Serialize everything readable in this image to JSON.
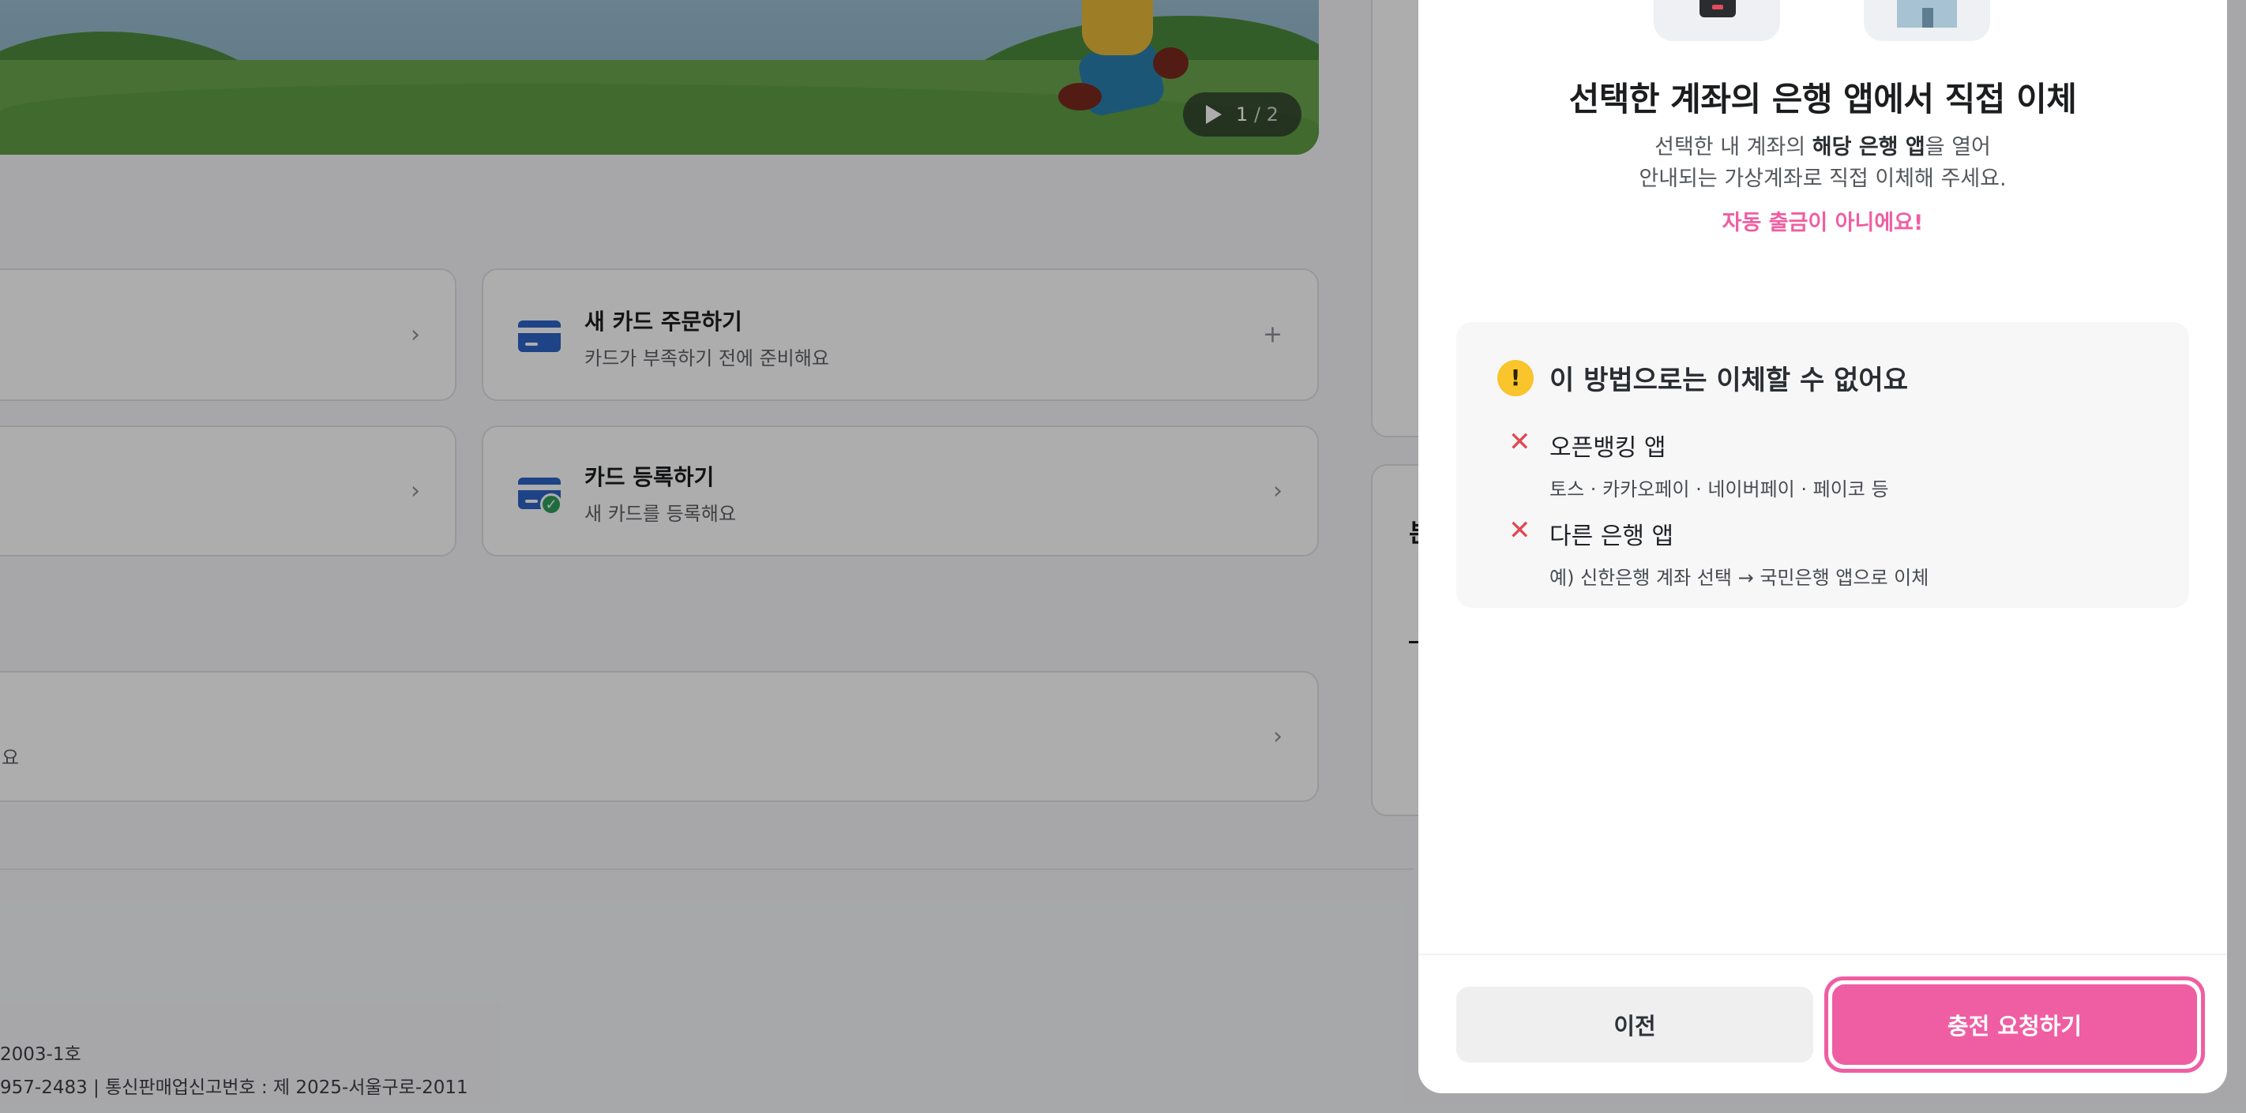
{
  "hero": {
    "counter_current": "1",
    "counter_sep": " / ",
    "counter_total": "2"
  },
  "cards": {
    "order_card": {
      "title": "새 카드 주문하기",
      "subtitle": "카드가 부족하기 전에 준비해요",
      "action_icon": "+",
      "icon": "credit-card-icon"
    },
    "register_card": {
      "title": "카드 등록하기",
      "subtitle": "새 카드를 등록해요",
      "action_icon": "›",
      "icon": "credit-card-check-icon"
    },
    "bottom_card_fragment": "요"
  },
  "right_col": {
    "fragment_1": "본"
  },
  "footer": {
    "line1": "2003-1호",
    "line2": "957-2483 | 통신판매업신고번호 : 제 2025-서울구로-2011"
  },
  "modal": {
    "title": "선택한 계좌의 은행 앱에서 직접 이체",
    "desc_line1_pre": "선택한 내 계좌의 ",
    "desc_line1_bold": "해당 은행 앱",
    "desc_line1_post": "을 열어",
    "desc_line2": "안내되는 가상계좌로 직접 이체해 주세요.",
    "warning": "자동 출금이 아니에요!",
    "notice": {
      "title": "이 방법으로는 이체할 수 없어요",
      "icon_glyph": "!",
      "items": [
        {
          "title": "오픈뱅킹 앱",
          "subtitle": "토스 · 카카오페이 · 네이버페이 · 페이코 등",
          "icon": "x-icon",
          "glyph": "✕"
        },
        {
          "title": "다른 은행 앱",
          "subtitle": "예) 신한은행 계좌 선택 → 국민은행 앱으로 이체",
          "icon": "x-icon",
          "glyph": "✕"
        }
      ]
    },
    "buttons": {
      "prev": "이전",
      "charge": "충전 요청하기"
    }
  },
  "colors": {
    "accent_pink": "#ef5ea2",
    "warning_yellow": "#f9c42c",
    "error_red": "#e2474f",
    "card_blue": "#2d63c6"
  }
}
